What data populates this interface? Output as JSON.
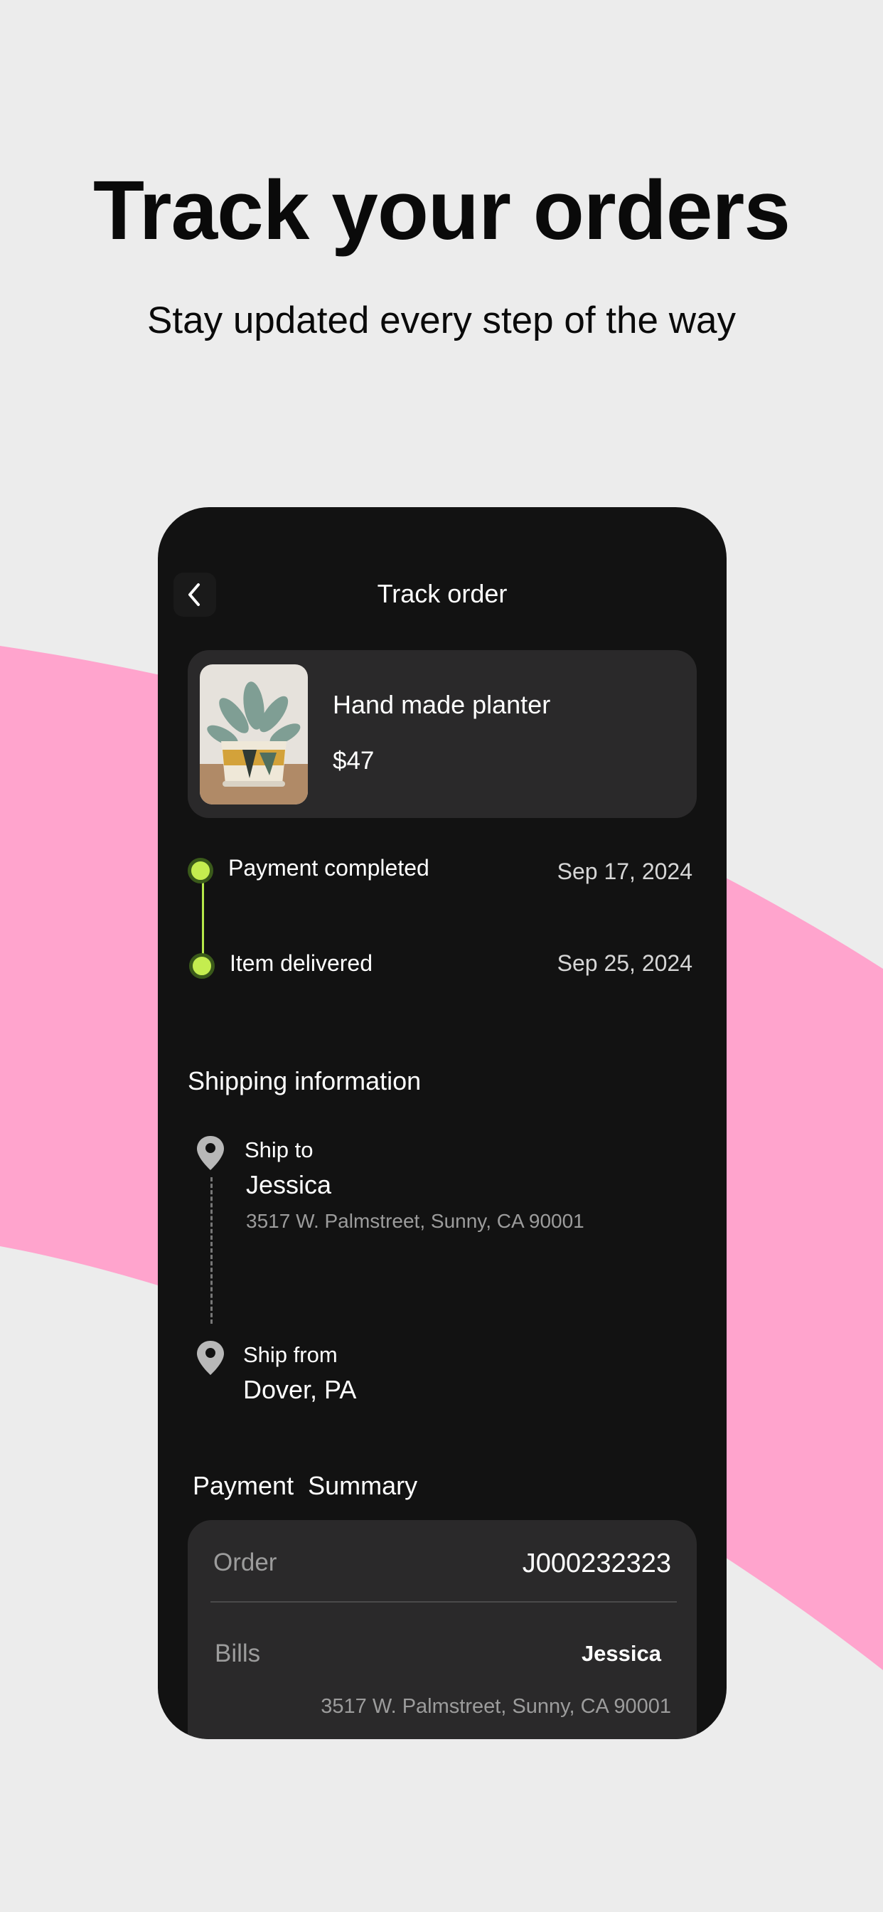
{
  "colors": {
    "background": "#ececec",
    "accent_pink": "#ffa4cd",
    "phone_bg": "#121212",
    "card_bg": "#2a292a",
    "timeline_green": "#c4ed4f"
  },
  "header": {
    "title": "Track your orders",
    "subtitle": "Stay updated every step of the way"
  },
  "screen": {
    "title": "Track order",
    "back_icon": "chevron-left-icon"
  },
  "product": {
    "name": "Hand made planter",
    "price": "$47"
  },
  "timeline": [
    {
      "label": "Payment completed",
      "date": "Sep 17, 2024"
    },
    {
      "label": "Item delivered",
      "date": "Sep 25, 2024"
    }
  ],
  "shipping": {
    "title": "Shipping information",
    "to": {
      "label": "Ship to",
      "name": "Jessica",
      "address": "3517 W. Palmstreet, Sunny, CA 90001"
    },
    "from": {
      "label": "Ship from",
      "place": "Dover, PA"
    },
    "icon": "location-pin-icon"
  },
  "payment": {
    "title": "Payment  Summary",
    "order_label": "Order",
    "order_value": "J000232323",
    "bills_label": "Bills",
    "bills_name": "Jessica",
    "bills_address": "3517 W. Palmstreet, Sunny, CA 90001"
  }
}
